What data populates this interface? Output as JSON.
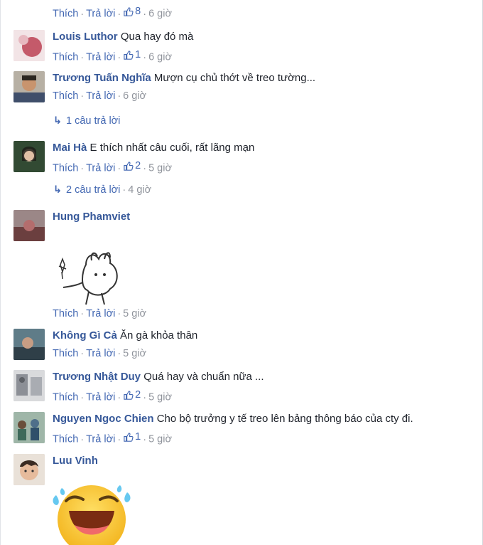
{
  "top_actions": {
    "like": "Thích",
    "reply": "Trả lời",
    "likes": "8",
    "time": "6 giờ"
  },
  "comments": [
    {
      "name": "Louis Luthor",
      "text": "Qua hay đó mà",
      "like": "Thích",
      "reply": "Trả lời",
      "likes": "1",
      "time": "6 giờ",
      "avatar_color": "#c45a6a"
    },
    {
      "name": "Trương Tuấn Nghĩa",
      "text": "Mượn cụ chủ thớt về treo tường...",
      "like": "Thích",
      "reply": "Trả lời",
      "likes": "",
      "time": "6 giờ",
      "avatar_color": "#8a7a64"
    },
    {
      "name": "Mai Hà",
      "text": "E thích nhất câu cuối, rất lãng mạn",
      "like": "Thích",
      "reply": "Trả lời",
      "likes": "2",
      "time": "5 giờ",
      "avatar_color": "#3d5a3c"
    },
    {
      "name": "Hung Phamviet",
      "text": "",
      "like": "Thích",
      "reply": "Trả lời",
      "likes": "",
      "time": "5 giờ",
      "avatar_color": "#7a4c4c"
    },
    {
      "name": "Không Gì Cả",
      "text": "Ăn gà khỏa thân",
      "like": "Thích",
      "reply": "Trả lời",
      "likes": "",
      "time": "5 giờ",
      "avatar_color": "#4b6a7c"
    },
    {
      "name": "Trương Nhật Duy",
      "text": "Quá hay và chuẩn nữa ...",
      "like": "Thích",
      "reply": "Trả lời",
      "likes": "2",
      "time": "5 giờ",
      "avatar_color": "#8c8f96"
    },
    {
      "name": "Nguyen Ngoc Chien",
      "text": "Cho bộ trưởng y tế treo lên bảng thông báo của cty đi.",
      "like": "Thích",
      "reply": "Trả lời",
      "likes": "1",
      "time": "5 giờ",
      "avatar_color": "#5f7f6a"
    },
    {
      "name": "Luu Vinh",
      "text": "",
      "avatar_color": "#d8b49a"
    }
  ],
  "reply_threads": [
    {
      "label": "1 câu trả lời",
      "time": ""
    },
    {
      "label": "2 câu trả lời",
      "time": "4 giờ"
    }
  ],
  "separator": "·"
}
